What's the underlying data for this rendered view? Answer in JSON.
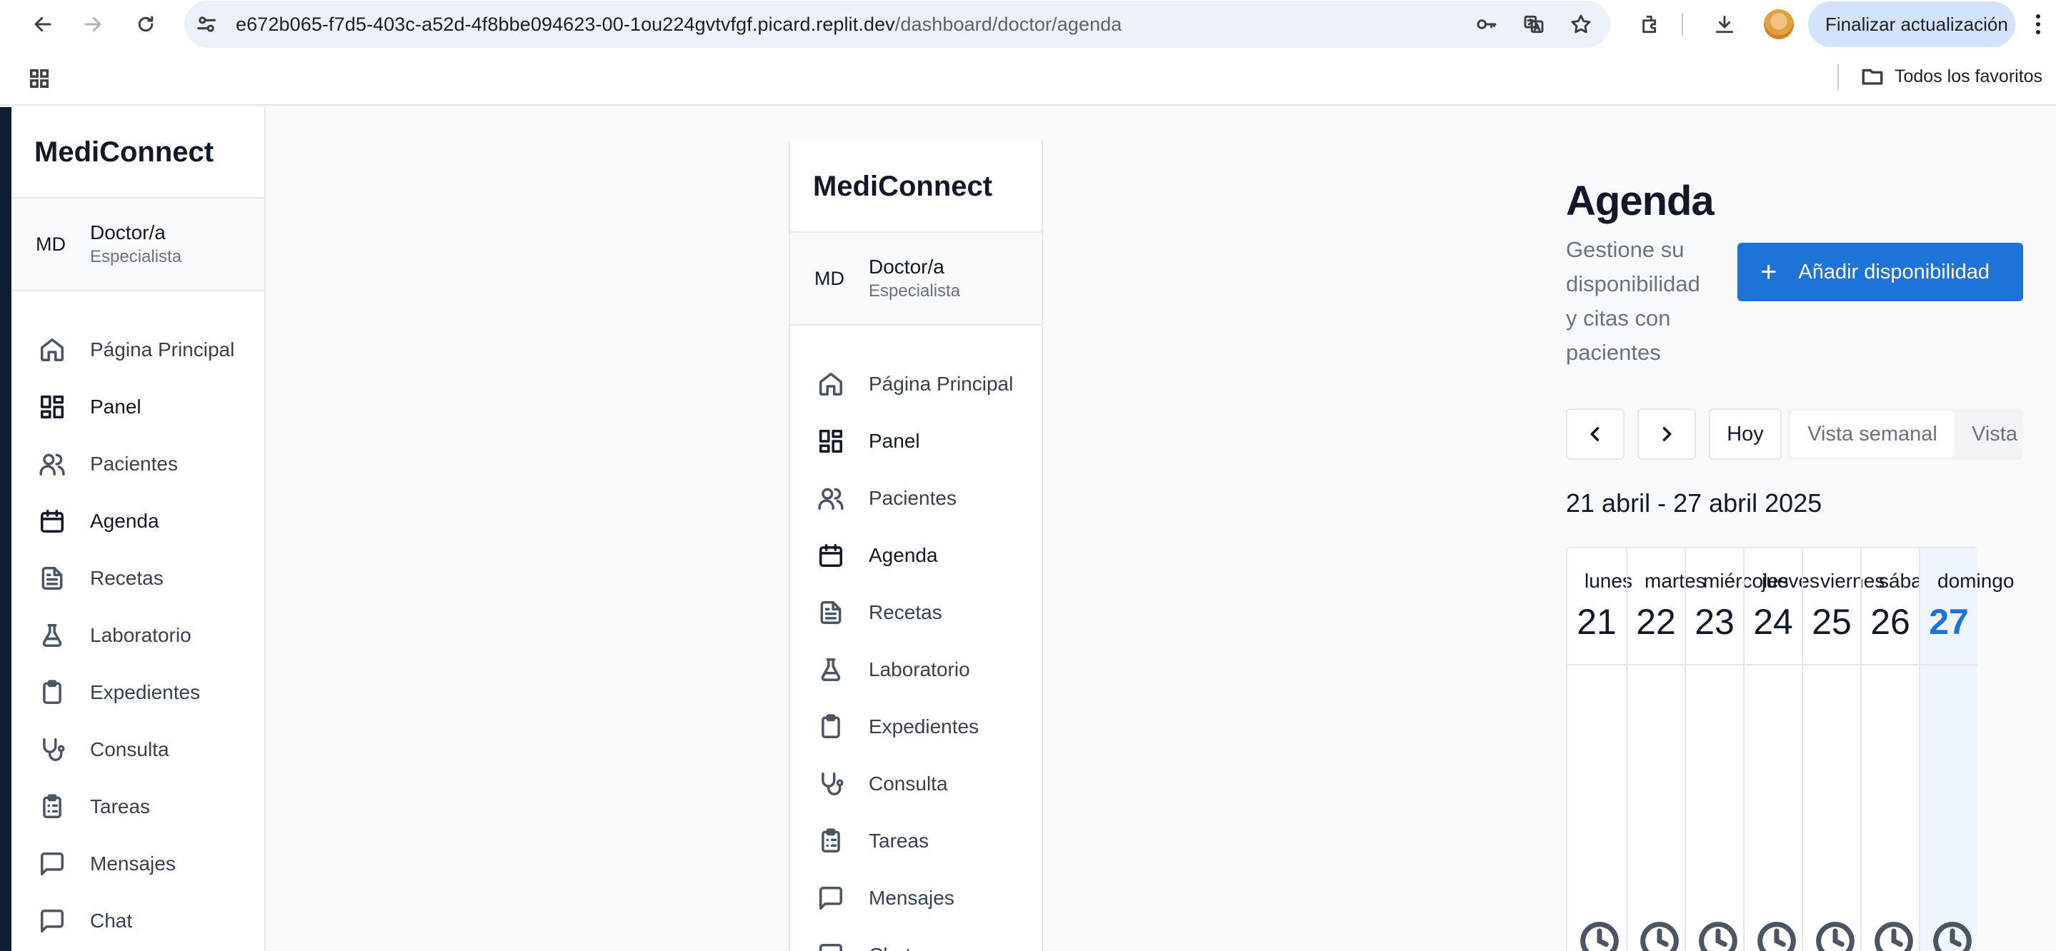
{
  "browser": {
    "url_host": "e672b065-f7d5-403c-a52d-4f8bbe094623-00-1ou224gvtvfgf.picard.replit.dev",
    "url_path": "/dashboard/doctor/agenda",
    "update_label": "Finalizar actualización",
    "bookmarks_folder": "Todos los favoritos"
  },
  "sidebar": {
    "brand": "MediConnect",
    "user_initials": "MD",
    "user_name": "Doctor/a",
    "user_role": "Especialista",
    "items": [
      {
        "label": "Página Principal",
        "icon": "home-icon"
      },
      {
        "label": "Panel",
        "icon": "dashboard-icon"
      },
      {
        "label": "Pacientes",
        "icon": "users-icon"
      },
      {
        "label": "Agenda",
        "icon": "calendar-icon"
      },
      {
        "label": "Recetas",
        "icon": "file-text-icon"
      },
      {
        "label": "Laboratorio",
        "icon": "flask-icon"
      },
      {
        "label": "Expedientes",
        "icon": "clipboard-icon"
      },
      {
        "label": "Consulta",
        "icon": "stethoscope-icon"
      },
      {
        "label": "Tareas",
        "icon": "clipboard-list-icon"
      },
      {
        "label": "Mensajes",
        "icon": "message-square-icon"
      },
      {
        "label": "Chat",
        "icon": "chat-icon"
      }
    ]
  },
  "main": {
    "title": "Agenda",
    "subtitle": "Gestione su disponibilidad y citas con pacientes",
    "add_button": "Añadir disponibilidad",
    "today_label": "Hoy",
    "view_week": "Vista semanal",
    "view_other": "Vista",
    "date_range": "21 abril - 27 abril 2025",
    "days": [
      {
        "name": "lunes",
        "num": "21"
      },
      {
        "name": "martes",
        "num": "22"
      },
      {
        "name": "miércoles",
        "num": "23"
      },
      {
        "name": "jueves",
        "num": "24"
      },
      {
        "name": "viernes",
        "num": "25"
      },
      {
        "name": "sábado",
        "num": "26"
      },
      {
        "name": "domingo",
        "num": "27"
      }
    ]
  },
  "colors": {
    "accent": "#1e73d8",
    "today_bg": "#eff6ff",
    "sidebar_edge": "#0f1d33"
  }
}
